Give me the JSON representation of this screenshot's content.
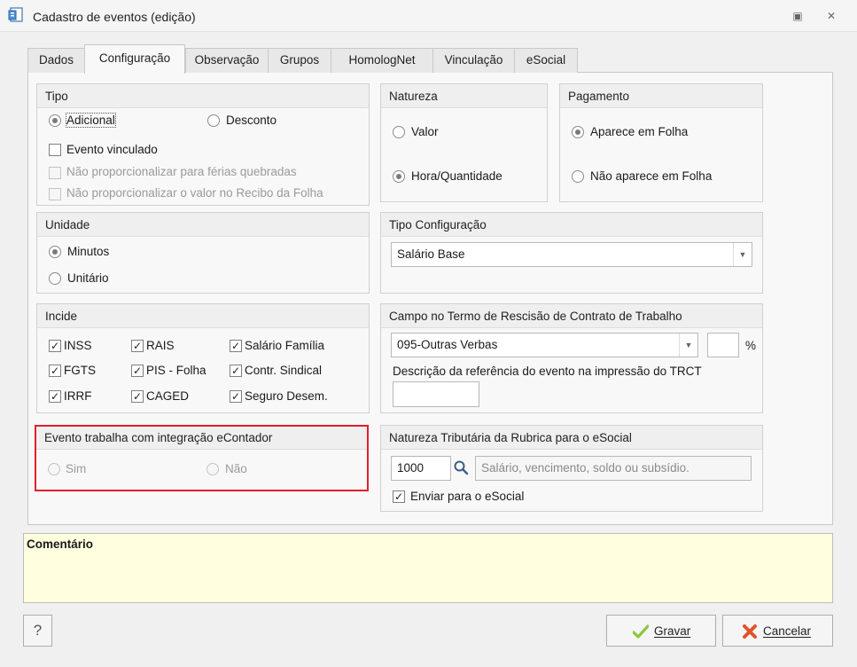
{
  "window": {
    "title": "Cadastro de eventos (edição)",
    "restore_symbol": "▣",
    "close_symbol": "✕"
  },
  "tabs": [
    {
      "label": "Dados"
    },
    {
      "label": "Configuração",
      "active": true
    },
    {
      "label": "Observação"
    },
    {
      "label": "Grupos"
    },
    {
      "label": "HomologNet"
    },
    {
      "label": "Vinculação"
    },
    {
      "label": "eSocial"
    }
  ],
  "tipo": {
    "title": "Tipo",
    "options": [
      {
        "label": "Adicional",
        "selected": true
      },
      {
        "label": "Desconto",
        "selected": false
      }
    ],
    "checks": [
      {
        "label": "Evento vinculado",
        "checked": false,
        "enabled": true
      },
      {
        "label": "Não proporcionalizar para férias quebradas",
        "checked": false,
        "enabled": false
      },
      {
        "label": "Não proporcionalizar o valor no Recibo da Folha",
        "checked": false,
        "enabled": false
      }
    ]
  },
  "natureza": {
    "title": "Natureza",
    "options": [
      {
        "label": "Valor",
        "selected": false
      },
      {
        "label": "Hora/Quantidade",
        "selected": true
      }
    ]
  },
  "pagamento": {
    "title": "Pagamento",
    "options": [
      {
        "label": "Aparece em Folha",
        "selected": true
      },
      {
        "label": "Não aparece em Folha",
        "selected": false
      }
    ]
  },
  "unidade": {
    "title": "Unidade",
    "options": [
      {
        "label": "Minutos",
        "selected": true
      },
      {
        "label": "Unitário",
        "selected": false
      }
    ]
  },
  "tipo_configuracao": {
    "title": "Tipo Configuração",
    "value": "Salário Base"
  },
  "incide": {
    "title": "Incide",
    "items": [
      {
        "label": "INSS",
        "checked": true
      },
      {
        "label": "RAIS",
        "checked": true
      },
      {
        "label": "Salário Família",
        "checked": true
      },
      {
        "label": "FGTS",
        "checked": true
      },
      {
        "label": "PIS - Folha",
        "checked": true
      },
      {
        "label": "Contr. Sindical",
        "checked": true
      },
      {
        "label": "IRRF",
        "checked": true
      },
      {
        "label": "CAGED",
        "checked": true
      },
      {
        "label": "Seguro Desem.",
        "checked": true
      }
    ]
  },
  "campo_trct": {
    "title": "Campo no Termo de Rescisão de Contrato de Trabalho",
    "value": "095-Outras Verbas",
    "percent_value": "",
    "percent_symbol": "%",
    "descricao_label": "Descrição da referência do evento na impressão do TRCT",
    "descricao_value": ""
  },
  "econtador": {
    "title": "Evento trabalha com integração eContador",
    "options": [
      {
        "label": "Sim",
        "selected": false
      },
      {
        "label": "Não",
        "selected": false
      }
    ]
  },
  "natureza_tributaria": {
    "title": "Natureza Tributária da Rubrica para o eSocial",
    "code": "1000",
    "description_placeholder": "Salário, vencimento, soldo ou subsídio.",
    "enviar_label": "Enviar para o eSocial",
    "enviar_checked": true
  },
  "comment": {
    "title": "Comentário",
    "text": ""
  },
  "buttons": {
    "help": "?",
    "save": "Gravar",
    "cancel": "Cancelar"
  },
  "colors": {
    "highlight": "#e0202a",
    "comment_bg": "#ffffe0",
    "save_icon": "#8cc63f",
    "cancel_icon": "#e2532a"
  }
}
